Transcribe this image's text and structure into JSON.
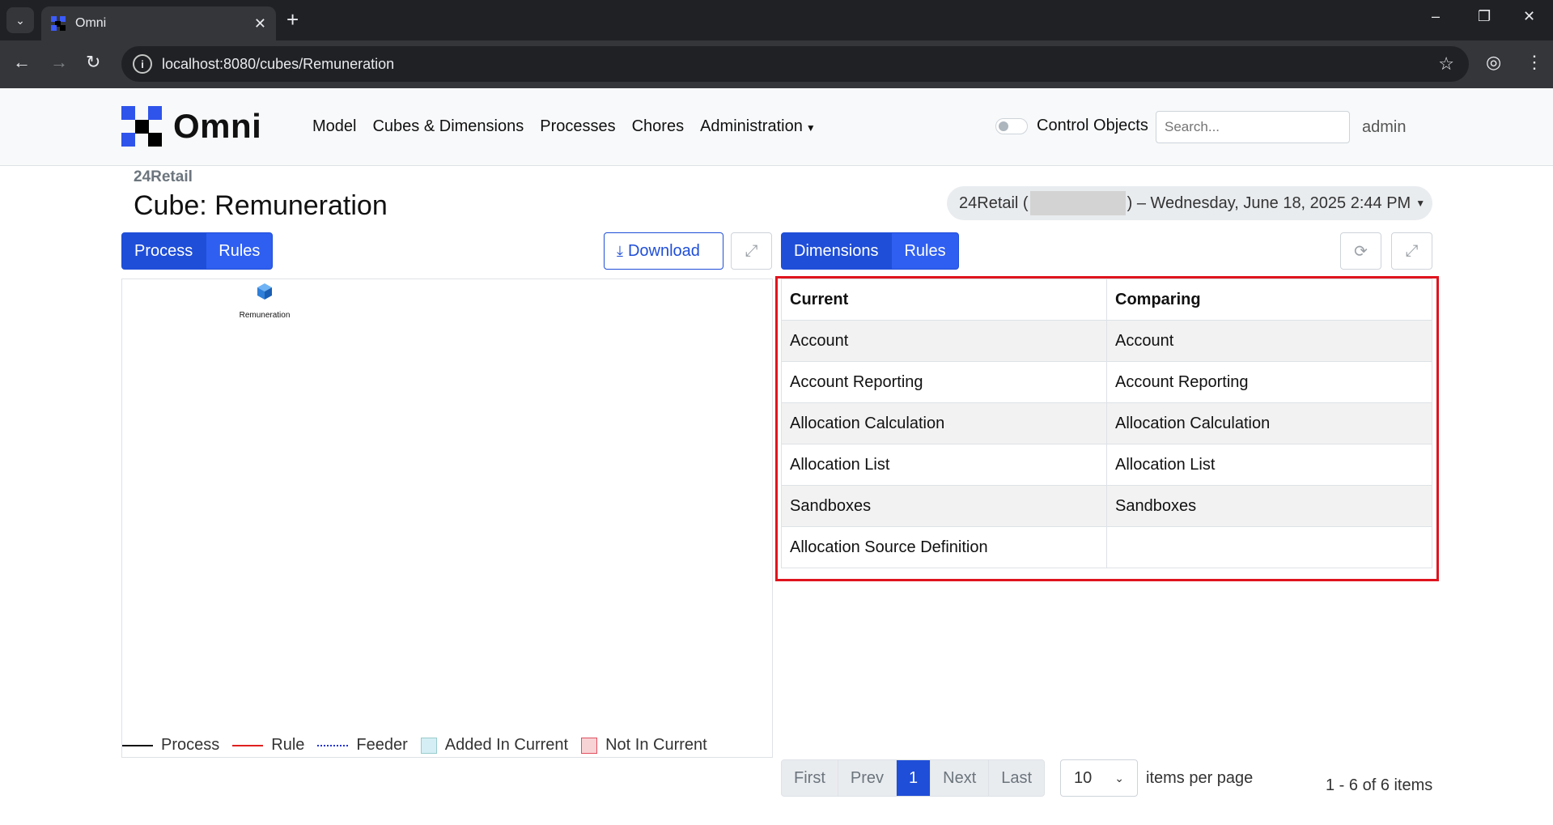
{
  "browser": {
    "tab_title": "Omni",
    "url": "localhost:8080/cubes/Remuneration"
  },
  "navbar": {
    "brand": "Omni",
    "menu": [
      "Model",
      "Cubes & Dimensions",
      "Processes",
      "Chores",
      "Administration"
    ],
    "control_objects_label": "Control Objects",
    "control_objects_on": false,
    "search_placeholder": "Search...",
    "user": "admin"
  },
  "header": {
    "breadcrumb": "24Retail",
    "title": "Cube: Remuneration",
    "compare_prefix": "24Retail (",
    "compare_suffix": ") – Wednesday, June 18, 2025 2:44 PM"
  },
  "left_panel": {
    "tabs": [
      "Process",
      "Rules"
    ],
    "download_label": "Download",
    "node_label": "Remuneration",
    "legend": [
      "Process",
      "Rule",
      "Feeder",
      "Added In Current",
      "Not In Current"
    ]
  },
  "right_panel": {
    "tabs": [
      "Dimensions",
      "Rules"
    ],
    "table": {
      "headers": [
        "Current",
        "Comparing"
      ],
      "rows": [
        [
          "Account",
          "Account"
        ],
        [
          "Account Reporting",
          "Account Reporting"
        ],
        [
          "Allocation Calculation",
          "Allocation Calculation"
        ],
        [
          "Allocation List",
          "Allocation List"
        ],
        [
          "Sandboxes",
          "Sandboxes"
        ],
        [
          "Allocation Source Definition",
          ""
        ]
      ]
    },
    "pagination": {
      "buttons": [
        "First",
        "Prev",
        "1",
        "Next",
        "Last"
      ],
      "per_page": "10",
      "per_page_label": "items per page",
      "range": "1 - 6 of 6 items"
    }
  },
  "colors": {
    "primary": "#1f4ed8",
    "highlight": "#e0141e",
    "rule_line": "#e02020",
    "feeder_line": "#2233cc"
  }
}
